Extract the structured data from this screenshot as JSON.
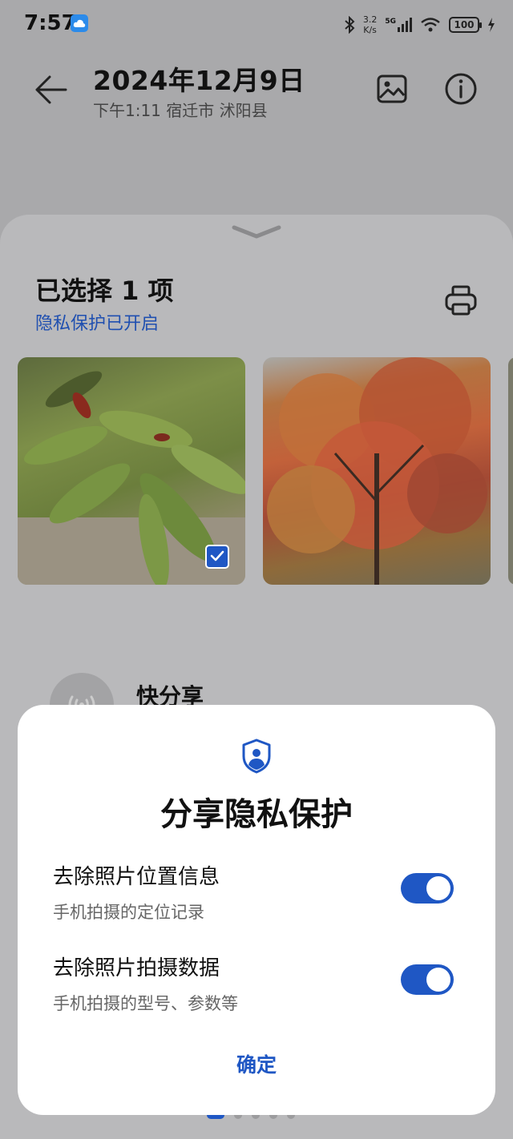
{
  "status_bar": {
    "time": "7:57",
    "net_speed_value": "3.2",
    "net_speed_unit": "K/s",
    "signal_label": "5G",
    "battery": "100"
  },
  "header": {
    "date": "2024年12月9日",
    "subtitle": "下午1:11 宿迁市 沭阳县"
  },
  "sheet": {
    "title": "已选择 1 项",
    "privacy_link": "隐私保护已开启",
    "quick_share": "快分享",
    "page_count": 5,
    "active_page": 1
  },
  "dialog": {
    "title": "分享隐私保护",
    "options": [
      {
        "title": "去除照片位置信息",
        "subtitle": "手机拍摄的定位记录",
        "enabled": true
      },
      {
        "title": "去除照片拍摄数据",
        "subtitle": "手机拍摄的型号、参数等",
        "enabled": true
      }
    ],
    "confirm": "确定"
  },
  "colors": {
    "accent": "#1f57c4",
    "link": "#1f4fb0",
    "dim_background": "#a9a9ab"
  },
  "icons": [
    "back-arrow-icon",
    "gallery-icon",
    "info-icon",
    "print-icon",
    "shield-user-icon",
    "wireless-share-icon",
    "check-icon"
  ]
}
